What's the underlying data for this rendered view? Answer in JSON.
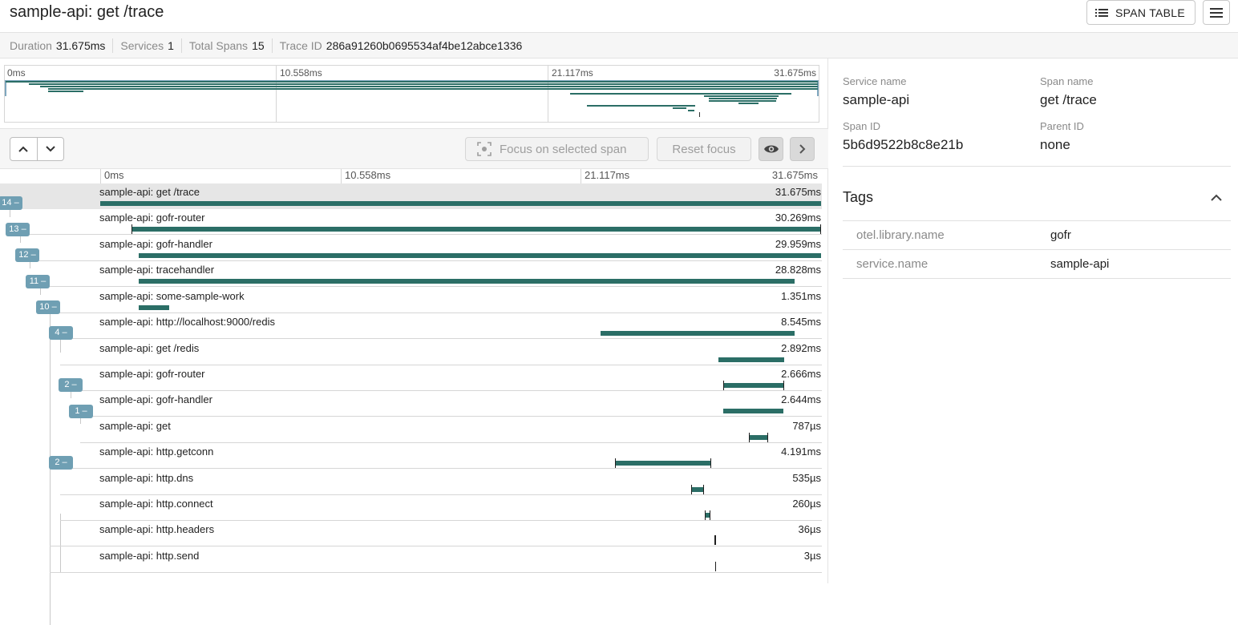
{
  "header": {
    "title": "sample-api: get /trace",
    "span_table_label": "SPAN TABLE"
  },
  "stats": [
    {
      "key": "Duration",
      "value": "31.675ms"
    },
    {
      "key": "Services",
      "value": "1"
    },
    {
      "key": "Total Spans",
      "value": "15"
    },
    {
      "key": "Trace ID",
      "value": "286a91260b0695534af4be12abce1336"
    }
  ],
  "timeline": {
    "ticks": [
      "0ms",
      "10.558ms",
      "21.117ms",
      "31.675ms"
    ]
  },
  "controls": {
    "focus_label": "Focus on selected span",
    "reset_label": "Reset focus"
  },
  "badges": [
    "14 –",
    "13 –",
    "12 –",
    "11 –",
    "10 –",
    "4 –",
    "2 –",
    "1 –",
    "2 –"
  ],
  "spans": [
    {
      "label": "sample-api: get /trace",
      "duration": "31.675ms"
    },
    {
      "label": "sample-api: gofr-router",
      "duration": "30.269ms"
    },
    {
      "label": "sample-api: gofr-handler",
      "duration": "29.959ms"
    },
    {
      "label": "sample-api: tracehandler",
      "duration": "28.828ms"
    },
    {
      "label": "sample-api: some-sample-work",
      "duration": "1.351ms"
    },
    {
      "label": "sample-api: http://localhost:9000/redis",
      "duration": "8.545ms"
    },
    {
      "label": "sample-api: get /redis",
      "duration": "2.892ms"
    },
    {
      "label": "sample-api: gofr-router",
      "duration": "2.666ms"
    },
    {
      "label": "sample-api: gofr-handler",
      "duration": "2.644ms"
    },
    {
      "label": "sample-api: get",
      "duration": "787µs"
    },
    {
      "label": "sample-api: http.getconn",
      "duration": "4.191ms"
    },
    {
      "label": "sample-api: http.dns",
      "duration": "535µs"
    },
    {
      "label": "sample-api: http.connect",
      "duration": "260µs"
    },
    {
      "label": "sample-api: http.headers",
      "duration": "36µs"
    },
    {
      "label": "sample-api: http.send",
      "duration": "3µs"
    }
  ],
  "detail": {
    "service_name_key": "Service name",
    "service_name": "sample-api",
    "span_name_key": "Span name",
    "span_name": "get /trace",
    "span_id_key": "Span ID",
    "span_id": "5b6d9522b8c8e21b",
    "parent_id_key": "Parent ID",
    "parent_id": "none",
    "tags_title": "Tags",
    "tags": [
      {
        "key": "otel.library.name",
        "value": "gofr"
      },
      {
        "key": "service.name",
        "value": "sample-api"
      }
    ]
  },
  "colors": {
    "bar": "#2b6e66",
    "badge": "#6f9fb3"
  }
}
